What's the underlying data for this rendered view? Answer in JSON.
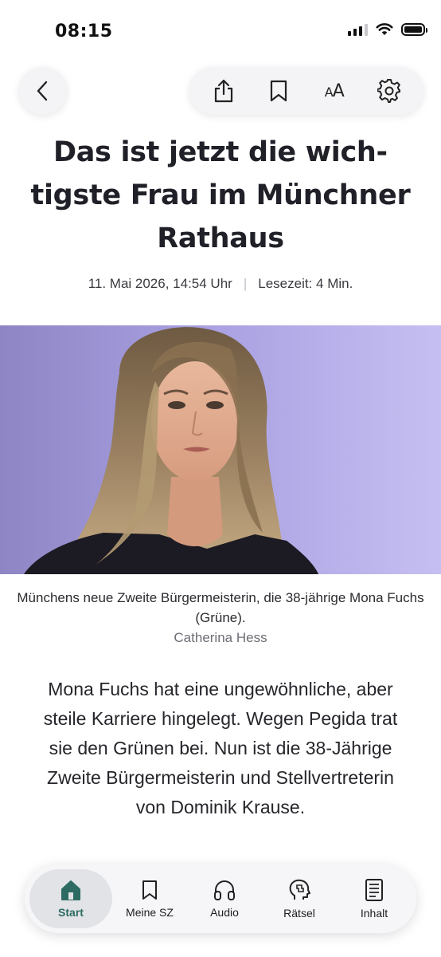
{
  "status_bar": {
    "time": "08:15"
  },
  "article": {
    "headline": "Das ist jetzt die wich­tigste Frau im Münch­ner Rathaus",
    "date": "11. Mai 2026, 14:54 Uhr",
    "reading_time": "Lesezeit: 4 Min.",
    "caption": "Münchens neue Zweite Bürgermeisterin, die 38-jährige Mona Fuchs (Grüne).",
    "photo_credit": "Catherina Hess",
    "teaser": "Mona Fuchs hat eine ungewöhnliche, aber steile Karriere hingelegt. Wegen Pegida trat sie den Grünen bei. Nun ist die 38-Jährige Zweite Bürgermeisterin und Stellvertreterin von Dominik Krause."
  },
  "toolbar": {
    "font_size_label": "AA",
    "icons": [
      "back-chevron-icon",
      "share-icon",
      "bookmark-icon",
      "text-size-icon",
      "gear-icon"
    ]
  },
  "tab_bar": {
    "tabs": [
      {
        "label": "Start",
        "icon": "home-icon",
        "active": true
      },
      {
        "label": "Meine SZ",
        "icon": "bookmark-icon",
        "active": false
      },
      {
        "label": "Audio",
        "icon": "headphones-icon",
        "active": false
      },
      {
        "label": "Rätsel",
        "icon": "puzzle-head-icon",
        "active": false
      },
      {
        "label": "Inhalt",
        "icon": "document-icon",
        "active": false
      }
    ]
  },
  "colors": {
    "accent": "#2d6b62",
    "text": "#1d1d22",
    "muted": "#6d6d75"
  }
}
